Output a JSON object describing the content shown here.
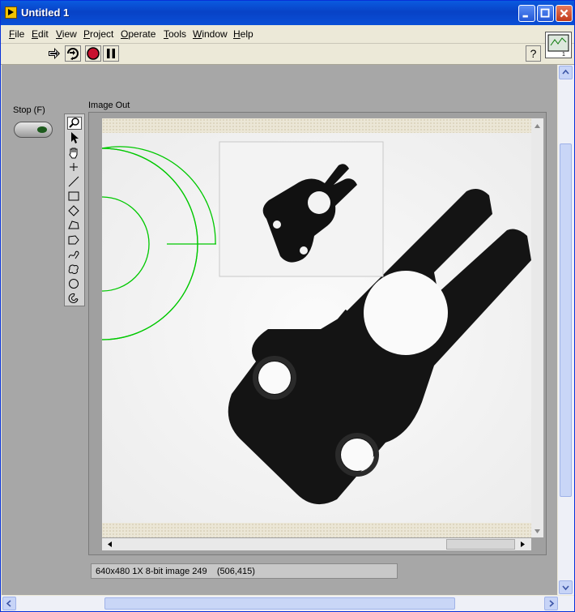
{
  "window": {
    "title": "Untitled 1"
  },
  "menu": [
    {
      "label": "File",
      "ul": "F",
      "rest": "ile"
    },
    {
      "label": "Edit",
      "ul": "E",
      "rest": "dit"
    },
    {
      "label": "View",
      "ul": "V",
      "rest": "iew"
    },
    {
      "label": "Project",
      "ul": "P",
      "rest": "roject"
    },
    {
      "label": "Operate",
      "ul": "O",
      "rest": "perate"
    },
    {
      "label": "Tools",
      "ul": "T",
      "rest": "ools"
    },
    {
      "label": "Window",
      "ul": "W",
      "rest": "indow"
    },
    {
      "label": "Help",
      "ul": "H",
      "rest": "elp"
    }
  ],
  "toolbar": {
    "run_icon": "run-arrow-icon",
    "run_continuous_icon": "run-continuously-icon",
    "abort_icon": "abort-stop-icon",
    "pause_icon": "pause-icon",
    "help_label": "?"
  },
  "controls": {
    "stop_label": "Stop (F)",
    "image_label": "Image Out"
  },
  "image_tools": [
    "zoom-icon",
    "pointer-icon",
    "pan-hand-icon",
    "point-icon",
    "line-icon",
    "rectangle-icon",
    "rotated-rectangle-icon",
    "polygon-icon",
    "broken-line-icon",
    "freehand-line-icon",
    "freehand-region-icon",
    "oval-icon",
    "annulus-icon"
  ],
  "status": {
    "text": "640x480 1X 8-bit image 249    (506,415)"
  },
  "colors": {
    "overlay": "#00c800",
    "accent": "#0a4fd6"
  }
}
